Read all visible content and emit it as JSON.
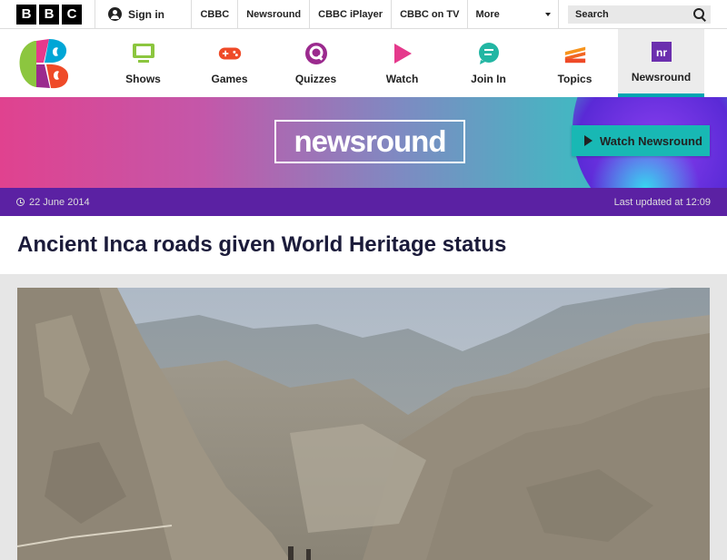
{
  "bbc_bar": {
    "logo_letters": [
      "B",
      "B",
      "C"
    ],
    "signin_label": "Sign in",
    "links": [
      "CBBC",
      "Newsround",
      "CBBC iPlayer",
      "CBBC on TV"
    ],
    "more_label": "More",
    "search_placeholder": "Search"
  },
  "cbbc_nav": {
    "items": [
      {
        "label": "Shows",
        "icon": "monitor-icon",
        "color": "#8cc63f"
      },
      {
        "label": "Games",
        "icon": "gamepad-icon",
        "color": "#ef4a28"
      },
      {
        "label": "Quizzes",
        "icon": "quiz-icon",
        "color": "#9b2a8e"
      },
      {
        "label": "Watch",
        "icon": "play-icon",
        "color": "#e5398c"
      },
      {
        "label": "Join In",
        "icon": "chat-icon",
        "color": "#22b6a3"
      },
      {
        "label": "Topics",
        "icon": "stack-icon",
        "color": "#f26522"
      },
      {
        "label": "Newsround",
        "icon": "nr-icon",
        "color": "#6b2fae",
        "active": true
      }
    ]
  },
  "banner": {
    "logo_text": "newsround",
    "watch_label": "Watch Newsround"
  },
  "article": {
    "date": "22 June 2014",
    "updated": "Last updated at 12:09",
    "title": "Ancient Inca roads given World Heritage status"
  },
  "colors": {
    "date_bar": "#5b21a3",
    "watch_button": "#18b8b4",
    "active_tab_underline": "#00a6b2"
  }
}
